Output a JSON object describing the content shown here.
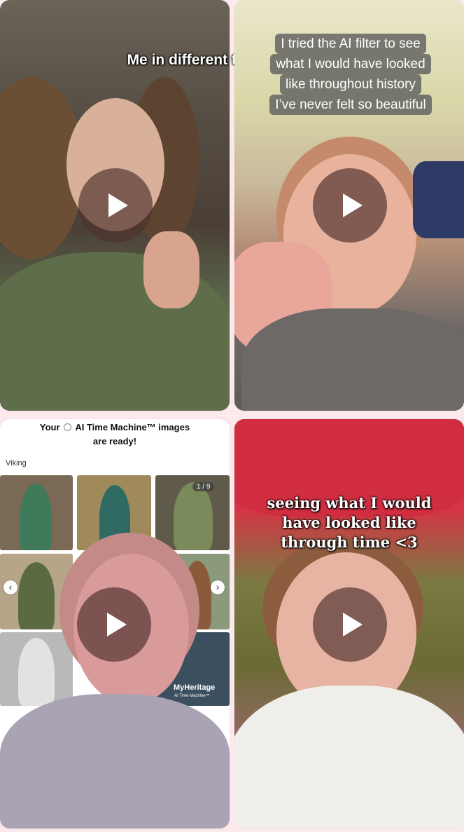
{
  "videos": [
    {
      "caption": "Me in different time periods??"
    },
    {
      "caption_lines": [
        "I tried the AI filter to see",
        "what I would have looked",
        "like throughout history",
        "I’ve never felt so beautiful"
      ]
    },
    {
      "screenshot": {
        "title_prefix": "Your",
        "title_app": "AI Time Machine™ images",
        "title_line2": "are ready!",
        "style_label": "Viking",
        "counter": "1 / 9",
        "prev_label": "‹",
        "next_label": "›",
        "brand": "MyHeritage",
        "brand_sub": "AI Time Machine™"
      }
    },
    {
      "caption_lines": [
        "seeing what I would",
        "have looked like",
        "through time <3"
      ]
    }
  ]
}
